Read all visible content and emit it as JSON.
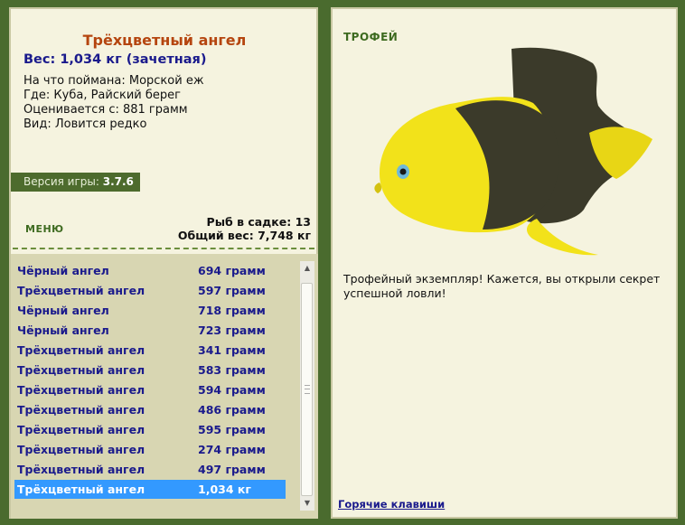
{
  "left": {
    "fish_title": "Трёхцветный ангел",
    "weight_line": "Вес: 1,034 кг (зачетная)",
    "info": [
      "На что поймана: Морской еж",
      "Где: Куба, Райский берег",
      "Оценивается с: 881 грамм",
      "Вид: Ловится редко"
    ],
    "version_label": "Версия игры:",
    "version_value": "3.7.6",
    "menu_label": "МЕНЮ",
    "keep_count": "Рыб в садке: 13",
    "total_weight": "Общий вес: 7,748 кг"
  },
  "catch_list": [
    {
      "name": "Чёрный ангел",
      "weight": "694 грамм"
    },
    {
      "name": "Трёхцветный ангел",
      "weight": "597 грамм"
    },
    {
      "name": "Чёрный ангел",
      "weight": "718 грамм"
    },
    {
      "name": "Чёрный ангел",
      "weight": "723 грамм"
    },
    {
      "name": "Трёхцветный ангел",
      "weight": "341 грамм"
    },
    {
      "name": "Трёхцветный ангел",
      "weight": "583 грамм"
    },
    {
      "name": "Трёхцветный ангел",
      "weight": "594 грамм"
    },
    {
      "name": "Трёхцветный ангел",
      "weight": "486 грамм"
    },
    {
      "name": "Трёхцветный ангел",
      "weight": "595 грамм"
    },
    {
      "name": "Трёхцветный ангел",
      "weight": "274 грамм"
    },
    {
      "name": "Трёхцветный ангел",
      "weight": "497 грамм"
    },
    {
      "name": "Трёхцветный ангел",
      "weight": "1,034 кг",
      "selected": true
    }
  ],
  "right": {
    "trophy_label": "ТРОФЕЙ",
    "trophy_text": "Трофейный экземпляр! Кажется, вы открыли секрет успешной ловли!",
    "hotkeys": "Горячие клавиши"
  },
  "colors": {
    "background": "#4a6b2e",
    "panel": "#f5f3df",
    "list_bg": "#d8d6b2",
    "selection": "#3399ff",
    "fish_yellow": "#f2e21a",
    "fish_dark": "#3b3a2a",
    "title_color": "#b5450f",
    "link_blue": "#1a1a8c"
  }
}
